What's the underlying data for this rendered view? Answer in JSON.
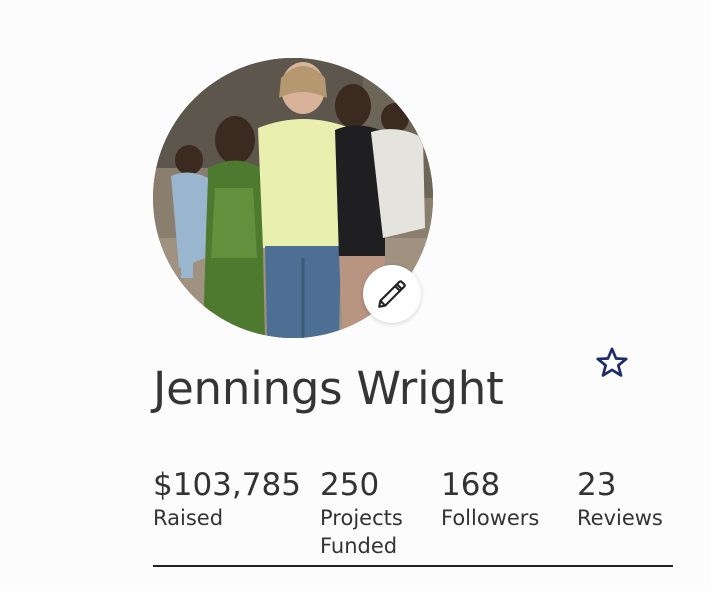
{
  "profile": {
    "name": "Jennings Wright"
  },
  "stats": [
    {
      "value": "$103,785",
      "label": "Raised"
    },
    {
      "value": "250",
      "label": "Projects\nFunded"
    },
    {
      "value": "168",
      "label": "Followers"
    },
    {
      "value": "23",
      "label": "Reviews"
    }
  ],
  "icons": {
    "edit": "pencil-icon",
    "favorite": "star-outline-icon"
  },
  "colors": {
    "star": "#1d2d6b",
    "text": "#333333",
    "divider": "#222222"
  }
}
